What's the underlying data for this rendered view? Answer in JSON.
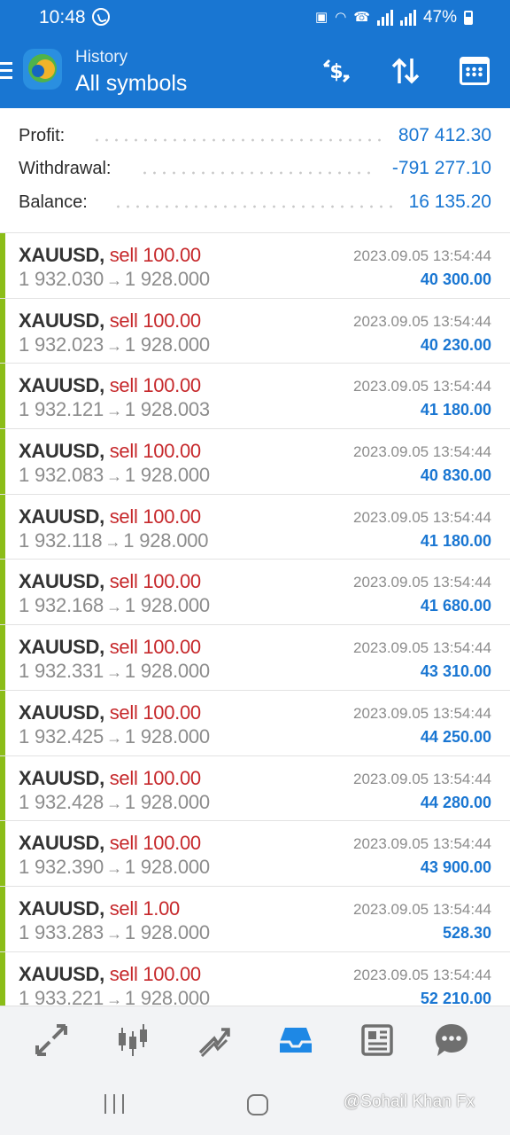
{
  "status_bar": {
    "time": "10:48",
    "battery": "47%"
  },
  "header": {
    "subtitle": "History",
    "title": "All symbols",
    "deposit_icon": "dollar-transfer-icon",
    "sort_icon": "sort-arrows-icon",
    "calendar_icon": "calendar-icon",
    "background_color": "#1976d2"
  },
  "summary": [
    {
      "label": "Profit:",
      "value": "807 412.30"
    },
    {
      "label": "Withdrawal:",
      "value": "-791 277.10"
    },
    {
      "label": "Balance:",
      "value": "16 135.20"
    }
  ],
  "colors": {
    "accent": "#1976d2",
    "sell": "#c6282b",
    "profit_bar": "#8bbd18"
  },
  "deals": [
    {
      "symbol": "XAUUSD,",
      "side": "sell 100.00",
      "open": "1 932.030",
      "close": "1 928.000",
      "time": "2023.09.05 13:54:44",
      "profit": "40 300.00"
    },
    {
      "symbol": "XAUUSD,",
      "side": "sell 100.00",
      "open": "1 932.023",
      "close": "1 928.000",
      "time": "2023.09.05 13:54:44",
      "profit": "40 230.00"
    },
    {
      "symbol": "XAUUSD,",
      "side": "sell 100.00",
      "open": "1 932.121",
      "close": "1 928.003",
      "time": "2023.09.05 13:54:44",
      "profit": "41 180.00"
    },
    {
      "symbol": "XAUUSD,",
      "side": "sell 100.00",
      "open": "1 932.083",
      "close": "1 928.000",
      "time": "2023.09.05 13:54:44",
      "profit": "40 830.00"
    },
    {
      "symbol": "XAUUSD,",
      "side": "sell 100.00",
      "open": "1 932.118",
      "close": "1 928.000",
      "time": "2023.09.05 13:54:44",
      "profit": "41 180.00"
    },
    {
      "symbol": "XAUUSD,",
      "side": "sell 100.00",
      "open": "1 932.168",
      "close": "1 928.000",
      "time": "2023.09.05 13:54:44",
      "profit": "41 680.00"
    },
    {
      "symbol": "XAUUSD,",
      "side": "sell 100.00",
      "open": "1 932.331",
      "close": "1 928.000",
      "time": "2023.09.05 13:54:44",
      "profit": "43 310.00"
    },
    {
      "symbol": "XAUUSD,",
      "side": "sell 100.00",
      "open": "1 932.425",
      "close": "1 928.000",
      "time": "2023.09.05 13:54:44",
      "profit": "44 250.00"
    },
    {
      "symbol": "XAUUSD,",
      "side": "sell 100.00",
      "open": "1 932.428",
      "close": "1 928.000",
      "time": "2023.09.05 13:54:44",
      "profit": "44 280.00"
    },
    {
      "symbol": "XAUUSD,",
      "side": "sell 100.00",
      "open": "1 932.390",
      "close": "1 928.000",
      "time": "2023.09.05 13:54:44",
      "profit": "43 900.00"
    },
    {
      "symbol": "XAUUSD,",
      "side": "sell 1.00",
      "open": "1 933.283",
      "close": "1 928.000",
      "time": "2023.09.05 13:54:44",
      "profit": "528.30"
    },
    {
      "symbol": "XAUUSD,",
      "side": "sell 100.00",
      "open": "1 933.221",
      "close": "1 928.000",
      "time": "2023.09.05 13:54:44",
      "profit": "52 210.00"
    }
  ],
  "bottom_nav": [
    {
      "icon": "quotes-icon"
    },
    {
      "icon": "chart-icon"
    },
    {
      "icon": "trade-icon"
    },
    {
      "icon": "history-icon",
      "active": true
    },
    {
      "icon": "news-icon"
    },
    {
      "icon": "messages-icon"
    }
  ],
  "watermark": "@Sohail Khan Fx"
}
